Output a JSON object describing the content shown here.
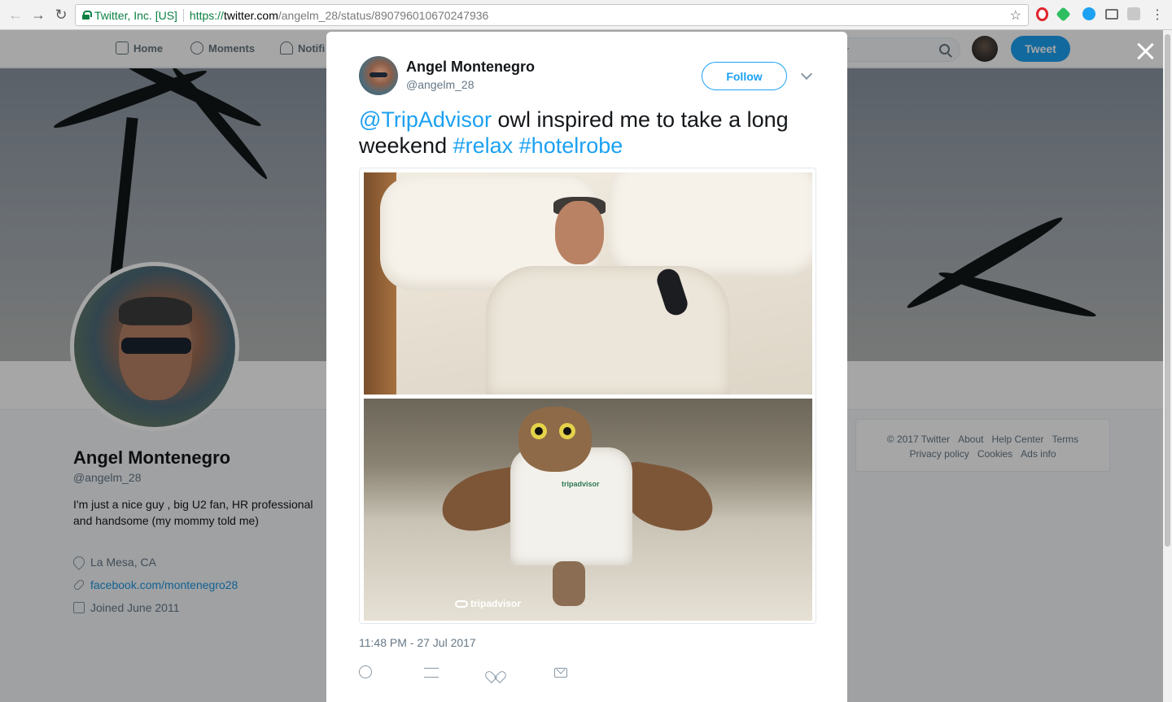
{
  "browser": {
    "secure_label": "Twitter, Inc. [US]",
    "url_scheme": "https://",
    "url_host": "twitter.com",
    "url_path": "/angelm_28/status/890796010670247936",
    "back_icon": "arrow-left-icon",
    "forward_icon": "arrow-right-icon",
    "reload_icon": "reload-icon",
    "bookmark_icon": "star-icon",
    "menu_icon": "kebab-menu-icon"
  },
  "twitter_nav": {
    "home_label": "Home",
    "moments_label": "Moments",
    "notifications_label": "Notifi",
    "search_placeholder": "r",
    "tweet_button_label": "Tweet"
  },
  "profile": {
    "name": "Angel Montenegro",
    "handle": "@angelm_28",
    "bio": "I'm just a nice guy , big U2 fan, HR professional and handsome (my mommy told me)",
    "location": "La Mesa, CA",
    "website": "facebook.com/montenegro28",
    "joined": "Joined June 2011"
  },
  "footer": {
    "copyright": "© 2017 Twitter",
    "about": "About",
    "help_center": "Help Center",
    "terms": "Terms",
    "privacy": "Privacy policy",
    "cookies": "Cookies",
    "ads_info": "Ads info"
  },
  "tweet": {
    "author_name": "Angel Montenegro",
    "author_handle": "@angelm_28",
    "follow_label": "Follow",
    "text_mention": "@TripAdvisor",
    "text_body": " owl inspired me to take a long weekend ",
    "hashtag_1": "#relax",
    "hashtag_2": "#hotelrobe",
    "image_watermark": "tripadvisor",
    "robe_logo": "tripadvisor",
    "timestamp": "11:48 PM - 27 Jul 2017"
  },
  "colors": {
    "accent": "#1da1f2",
    "text": "#14171a",
    "muted": "#657786",
    "secure_green": "#0b8043"
  }
}
